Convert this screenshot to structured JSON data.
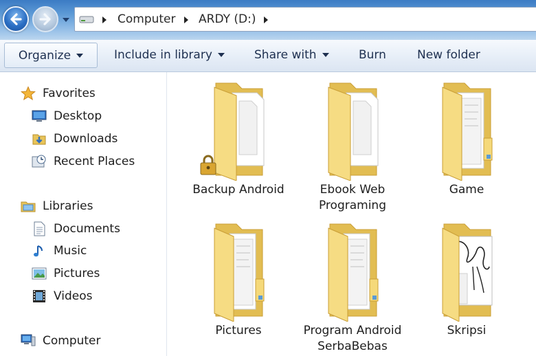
{
  "address": {
    "breadcrumbs": [
      "Computer",
      "ARDY (D:)"
    ]
  },
  "toolbar": {
    "organize": "Organize",
    "include_in_library": "Include in library",
    "share_with": "Share with",
    "burn": "Burn",
    "new_folder": "New folder"
  },
  "nav": {
    "favorites": {
      "label": "Favorites",
      "icon": "star-icon"
    },
    "favorites_items": [
      {
        "label": "Desktop",
        "icon": "desktop-icon"
      },
      {
        "label": "Downloads",
        "icon": "downloads-icon"
      },
      {
        "label": "Recent Places",
        "icon": "recent-places-icon"
      }
    ],
    "libraries": {
      "label": "Libraries",
      "icon": "libraries-icon"
    },
    "library_items": [
      {
        "label": "Documents",
        "icon": "documents-icon"
      },
      {
        "label": "Music",
        "icon": "music-icon"
      },
      {
        "label": "Pictures",
        "icon": "pictures-icon"
      },
      {
        "label": "Videos",
        "icon": "videos-icon"
      }
    ],
    "computer": {
      "label": "Computer",
      "icon": "computer-icon"
    }
  },
  "folders": [
    {
      "name": "Backup Android",
      "locked": true,
      "style": "documents"
    },
    {
      "name": "Ebook Web\nPrograming",
      "locked": false,
      "style": "documents"
    },
    {
      "name": "Game",
      "locked": false,
      "style": "files"
    },
    {
      "name": "Pictures",
      "locked": false,
      "style": "files"
    },
    {
      "name": "Program Android\nSerbaBebas",
      "locked": false,
      "style": "files"
    },
    {
      "name": "Skripsi",
      "locked": false,
      "style": "sketch"
    }
  ],
  "colors": {
    "folder_front": "#f5d97a",
    "folder_back": "#e8c45a",
    "accent": "#3b7bc4"
  }
}
